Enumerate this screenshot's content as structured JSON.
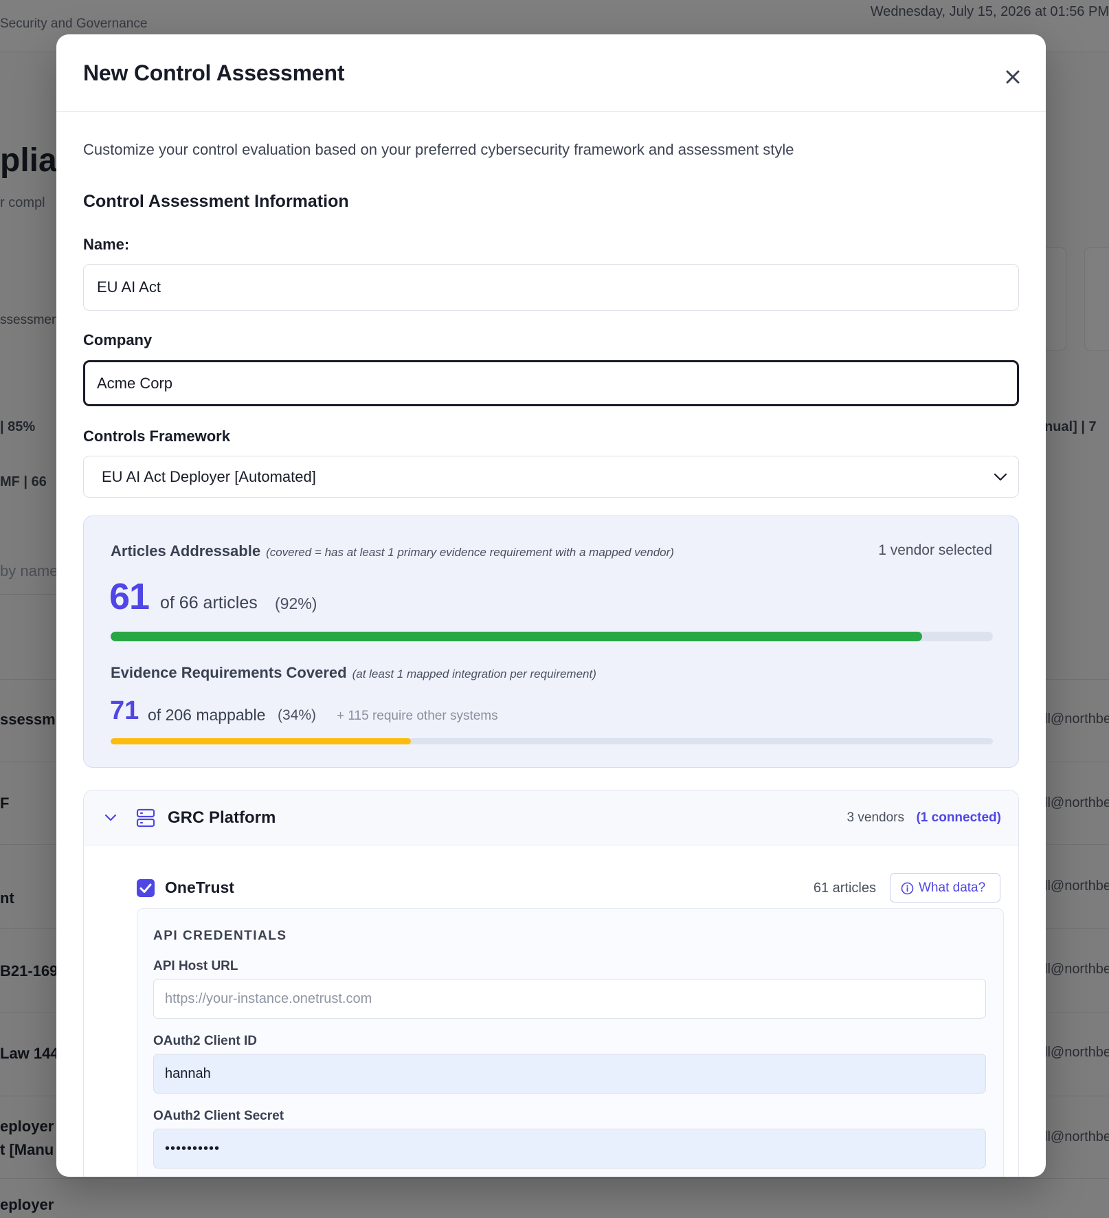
{
  "background": {
    "breadcrumb": "Security and Governance",
    "datetime": "Wednesday, July 15, 2026 at 01:56 PM",
    "title_fragment": "plian",
    "subtitle_fragment": "r compl",
    "assessment_fragment": "ssessmen",
    "stat_left": "|   85%",
    "stat_right": "nual]   |   7",
    "mf_fragment": "MF   |   66",
    "search_fragment": "by name",
    "rows": [
      {
        "left": "ssessm",
        "right": "ll@northbe"
      },
      {
        "left": "F",
        "right": "ll@northbe"
      },
      {
        "left": "nt",
        "right": "ll@northbe"
      },
      {
        "left": "B21-169",
        "right": "ll@northbe"
      },
      {
        "left": "Law 144",
        "right": "ll@northbe"
      },
      {
        "left": "eployer\nt [Manu",
        "right": "ll@northbe"
      },
      {
        "left": "eployer",
        "right": ""
      }
    ]
  },
  "modal": {
    "title": "New Control Assessment",
    "close_icon": "close-icon",
    "intro": "Customize your control evaluation based on your preferred cybersecurity framework and assessment style",
    "section_title": "Control Assessment Information",
    "name_label": "Name:",
    "name_value": "EU AI Act",
    "company_label": "Company",
    "company_value": "Acme Corp",
    "framework_label": "Controls Framework",
    "framework_value": "EU AI Act Deployer [Automated]"
  },
  "coverage": {
    "articles_title": "Articles Addressable",
    "articles_note": "(covered = has at least 1 primary evidence requirement with a mapped vendor)",
    "vendors_selected": "1 vendor selected",
    "articles_count": "61",
    "articles_of": "of 66 articles",
    "articles_pct": "(92%)",
    "articles_fraction": 0.92,
    "articles_color": "#28a745",
    "evidence_title": "Evidence Requirements Covered",
    "evidence_note": "(at least 1 mapped integration per requirement)",
    "evidence_count": "71",
    "evidence_of": "of 206 mappable",
    "evidence_pct": "(34%)",
    "evidence_other": "+ 115 require other systems",
    "evidence_fraction": 0.34,
    "evidence_color": "#fbbc0c"
  },
  "category": {
    "title": "GRC Platform",
    "icon": "server-icon",
    "vendor_count": "3 vendors",
    "connected": "(1 connected)",
    "vendor": {
      "name": "OneTrust",
      "checked": true,
      "articles": "61 articles",
      "what_data_label": "What data?",
      "credentials": {
        "title": "API CREDENTIALS",
        "host_label": "API Host URL",
        "host_placeholder": "https://your-instance.onetrust.com",
        "client_id_label": "OAuth2 Client ID",
        "client_id_value": "hannah",
        "client_secret_label": "OAuth2 Client Secret",
        "client_secret_value": "••••••••••"
      }
    }
  }
}
